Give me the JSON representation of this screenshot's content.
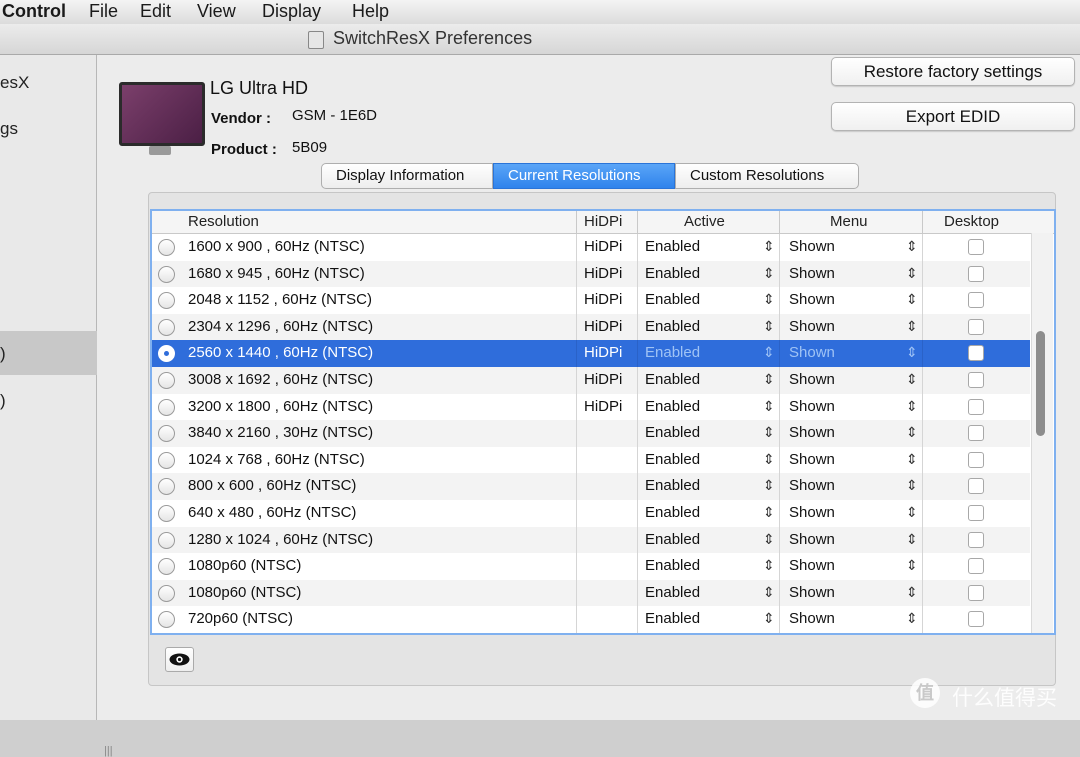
{
  "menubar": {
    "app": "Control",
    "items": [
      "File",
      "Edit",
      "View",
      "Display",
      "Help"
    ]
  },
  "window": {
    "title": "SwitchResX Preferences"
  },
  "sidebar": {
    "items": [
      "esX",
      "gs",
      ")",
      ")"
    ]
  },
  "display": {
    "name": "LG Ultra HD",
    "vendor_label": "Vendor :",
    "vendor": "GSM - 1E6D",
    "product_label": "Product :",
    "product": "5B09"
  },
  "buttons": {
    "restore": "Restore factory settings",
    "export": "Export EDID"
  },
  "tabs": [
    "Display Information",
    "Current Resolutions",
    "Custom Resolutions"
  ],
  "table": {
    "headers": [
      "Resolution",
      "HiDPi",
      "Active",
      "Menu",
      "Desktop"
    ],
    "rows": [
      {
        "res": "1600 x 900    , 60Hz (NTSC)",
        "hidpi": "HiDPi",
        "active": "Enabled",
        "menu": "Shown"
      },
      {
        "res": "1680 x 945    , 60Hz (NTSC)",
        "hidpi": "HiDPi",
        "active": "Enabled",
        "menu": "Shown"
      },
      {
        "res": "2048 x 1152 , 60Hz (NTSC)",
        "hidpi": "HiDPi",
        "active": "Enabled",
        "menu": "Shown"
      },
      {
        "res": "2304 x 1296 , 60Hz (NTSC)",
        "hidpi": "HiDPi",
        "active": "Enabled",
        "menu": "Shown"
      },
      {
        "res": "2560 x 1440 , 60Hz (NTSC)",
        "hidpi": "HiDPi",
        "active": "Enabled",
        "menu": "Shown",
        "selected": true
      },
      {
        "res": "3008 x 1692 , 60Hz (NTSC)",
        "hidpi": "HiDPi",
        "active": "Enabled",
        "menu": "Shown"
      },
      {
        "res": "3200 x 1800 , 60Hz (NTSC)",
        "hidpi": "HiDPi",
        "active": "Enabled",
        "menu": "Shown"
      },
      {
        "res": "3840 x 2160 , 30Hz (NTSC)",
        "hidpi": "",
        "active": "Enabled",
        "menu": "Shown"
      },
      {
        "res": "1024 x 768    , 60Hz (NTSC)",
        "hidpi": "",
        "active": "Enabled",
        "menu": "Shown"
      },
      {
        "res": "  800 x 600    , 60Hz (NTSC)",
        "hidpi": "",
        "active": "Enabled",
        "menu": "Shown"
      },
      {
        "res": "  640 x 480    , 60Hz (NTSC)",
        "hidpi": "",
        "active": "Enabled",
        "menu": "Shown"
      },
      {
        "res": "1280 x 1024 , 60Hz (NTSC)",
        "hidpi": "",
        "active": "Enabled",
        "menu": "Shown"
      },
      {
        "res": "1080p60 (NTSC)",
        "hidpi": "",
        "active": "Enabled",
        "menu": "Shown"
      },
      {
        "res": "1080p60 (NTSC)",
        "hidpi": "",
        "active": "Enabled",
        "menu": "Shown"
      },
      {
        "res": "720p60 (NTSC)",
        "hidpi": "",
        "active": "Enabled",
        "menu": "Shown"
      }
    ]
  },
  "watermark": {
    "logo": "值",
    "text": "什么值得买"
  },
  "colors": {
    "accent": "#2f6ddb",
    "tab_active": "#3a8df0",
    "focus_ring": "#7fb0ef"
  },
  "icons": {
    "eye": "eye-icon",
    "stepper": "up-down-chevron-icon",
    "doc": "document-icon"
  }
}
